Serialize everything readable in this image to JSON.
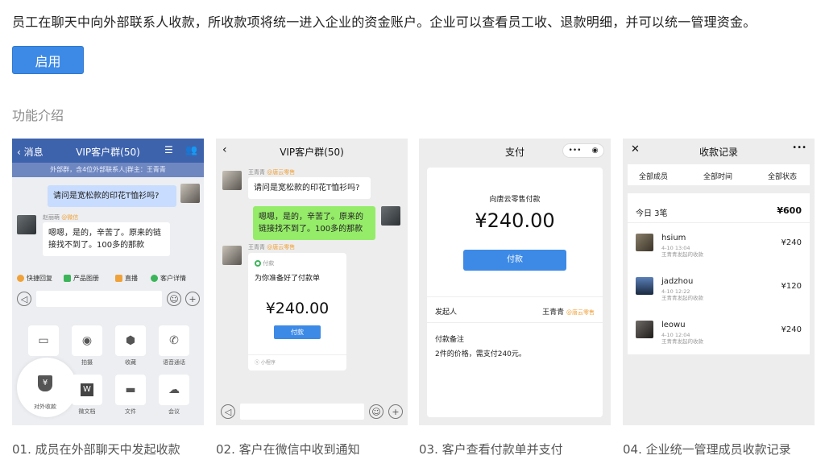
{
  "description": "员工在聊天中向外部联系人收款，所收款项将统一进入企业的资金账户。企业可以查看员工收、退款明细，并可以统一管理资金。",
  "enable_button": "启用",
  "section_title": "功能介绍",
  "captions": [
    "01. 成员在外部聊天中发起收款",
    "02. 客户在微信中收到通知",
    "03. 客户查看付款单并支付",
    "04. 企业统一管理成员收款记录"
  ],
  "panel1": {
    "back": "消息",
    "title": "VIP客户群(50)",
    "subtitle": "外部群，含4位外部联系人|群主：王青青",
    "question": "请问是宽松款的印花T恤衫吗?",
    "sender_name": "赵丽萌",
    "sender_tag": "@微信",
    "reply": "嗯嗯，是的，辛苦了。原来的链接找不到了。100多的那款",
    "tools": [
      "快捷回复",
      "产品图册",
      "直播",
      "客户详情"
    ],
    "grid_row1": [
      "",
      "拍摄",
      "收藏",
      "语音通话"
    ],
    "grid_row2": [
      "对外收款",
      "微文档",
      "文件",
      "会议"
    ],
    "money_glyph": "¥",
    "doc_glyph": "W"
  },
  "panel2": {
    "title": "VIP客户群(50)",
    "sender_name": "王青青",
    "sender_tag": "@唐云零售",
    "question": "请问是宽松款的印花T恤衫吗?",
    "reply": "嗯嗯，是的，辛苦了。原来的链接找不到了。100多的那款",
    "card_tag": "付款",
    "card_title": "为你准备好了付款单",
    "card_amount": "¥240.00",
    "card_button": "付款",
    "card_footer": "小程序"
  },
  "panel3": {
    "title": "支付",
    "payee": "向唐云零售付款",
    "amount": "¥240.00",
    "button": "付款",
    "initiator_label": "发起人",
    "initiator_name": "王青青",
    "initiator_tag": "@唐云零售",
    "note_label": "付款备注",
    "note_text": "2件的价格，需支付240元。"
  },
  "panel4": {
    "title": "收款记录",
    "filters": [
      "全部成员",
      "全部时间",
      "全部状态"
    ],
    "summary_label": "今日 3笔",
    "summary_amount": "¥600",
    "records": [
      {
        "name": "hsium",
        "time": "4-10 13:04",
        "note": "王青青发起的收款",
        "amount": "¥240"
      },
      {
        "name": "jadzhou",
        "time": "4-10 12:22",
        "note": "王青青发起的收款",
        "amount": "¥120"
      },
      {
        "name": "leowu",
        "time": "4-10 12:04",
        "note": "王青青发起的收款",
        "amount": "¥240"
      }
    ]
  },
  "colors": {
    "accent": "#3d8ae6",
    "wechat_green": "#95ec69",
    "tag_orange": "#f0a23a"
  }
}
